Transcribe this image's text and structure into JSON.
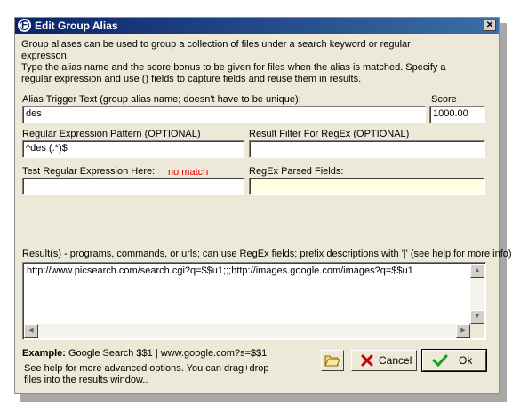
{
  "window": {
    "title": "Edit Group Alias",
    "close_glyph": "✕",
    "icon": "F"
  },
  "description": "Group aliases can be used to group a collection of files under a search keyword or regular expresson.\nType the alias name and the score bonus to be given for files when the alias is matched.  Specify a regular expression and use () fields to capture fields and reuse them in results.",
  "alias": {
    "label": "Alias Trigger Text (group alias name; doesn't have to be unique):",
    "value": "des"
  },
  "score": {
    "label": "Score",
    "value": "1000.00"
  },
  "regex": {
    "label": "Regular Expression Pattern (OPTIONAL)",
    "value": "^des (.*)$"
  },
  "result_filter": {
    "label": "Result Filter For RegEx (OPTIONAL)",
    "value": ""
  },
  "test_regex": {
    "label": "Test Regular Expression Here:",
    "value": "",
    "status": "no match"
  },
  "parsed_fields": {
    "label": "RegEx Parsed Fields:",
    "value": ""
  },
  "results": {
    "label": "Result(s) - programs, commands, or urls; can use RegEx fields; prefix descriptions with '|' (see help for more info)",
    "value": "http://www.picsearch.com/search.cgi?q=$$u1;;;http://images.google.com/images?q=$$u1"
  },
  "example": {
    "label": "Example:",
    "text": "Google Search $$1 | www.google.com?s=$$1"
  },
  "help_text": "See help for more advanced options.  You can drag+drop files into the results window..",
  "buttons": {
    "open_icon": "folder-open-icon",
    "cancel": "Cancel",
    "ok": "Ok"
  },
  "colors": {
    "titlebar": "#0a246a",
    "parsed_fields_bg": "#ffffe1",
    "status": "#e00000",
    "cancel_icon": "#cc0000",
    "ok_icon": "#1a9a1a"
  }
}
